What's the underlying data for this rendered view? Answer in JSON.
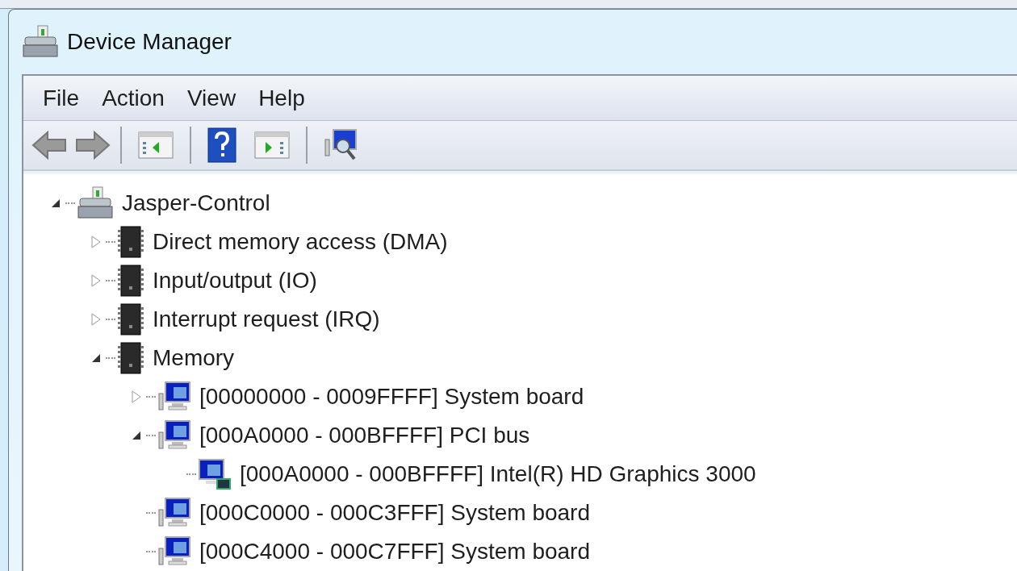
{
  "window": {
    "title": "Device Manager"
  },
  "menu": [
    {
      "label": "File"
    },
    {
      "label": "Action"
    },
    {
      "label": "View"
    },
    {
      "label": "Help"
    }
  ],
  "toolbar": [
    {
      "kind": "back"
    },
    {
      "kind": "forward"
    },
    {
      "kind": "separator"
    },
    {
      "kind": "hide-pane"
    },
    {
      "kind": "separator"
    },
    {
      "kind": "help"
    },
    {
      "kind": "show-pane"
    },
    {
      "kind": "separator"
    },
    {
      "kind": "scan"
    }
  ],
  "tree": [
    {
      "label": "Jasper-Control",
      "kind": "computer",
      "expanded": true,
      "children": [
        {
          "label": "Direct memory access (DMA)",
          "kind": "chip",
          "expanded": false
        },
        {
          "label": "Input/output (IO)",
          "kind": "chip",
          "expanded": false
        },
        {
          "label": "Interrupt request (IRQ)",
          "kind": "chip",
          "expanded": false
        },
        {
          "label": "Memory",
          "kind": "chip",
          "expanded": true,
          "children": [
            {
              "label": "[00000000 - 0009FFFF]  System board",
              "kind": "monitor",
              "expanded": false
            },
            {
              "label": "[000A0000 - 000BFFFF]  PCI bus",
              "kind": "monitor",
              "expanded": true,
              "children": [
                {
                  "label": "[000A0000 - 000BFFFF]  Intel(R) HD Graphics 3000",
                  "kind": "display-adapter"
                }
              ]
            },
            {
              "label": "[000C0000 - 000C3FFF]  System board",
              "kind": "monitor"
            },
            {
              "label": "[000C4000 - 000C7FFF]  System board",
              "kind": "monitor"
            }
          ]
        }
      ]
    }
  ]
}
